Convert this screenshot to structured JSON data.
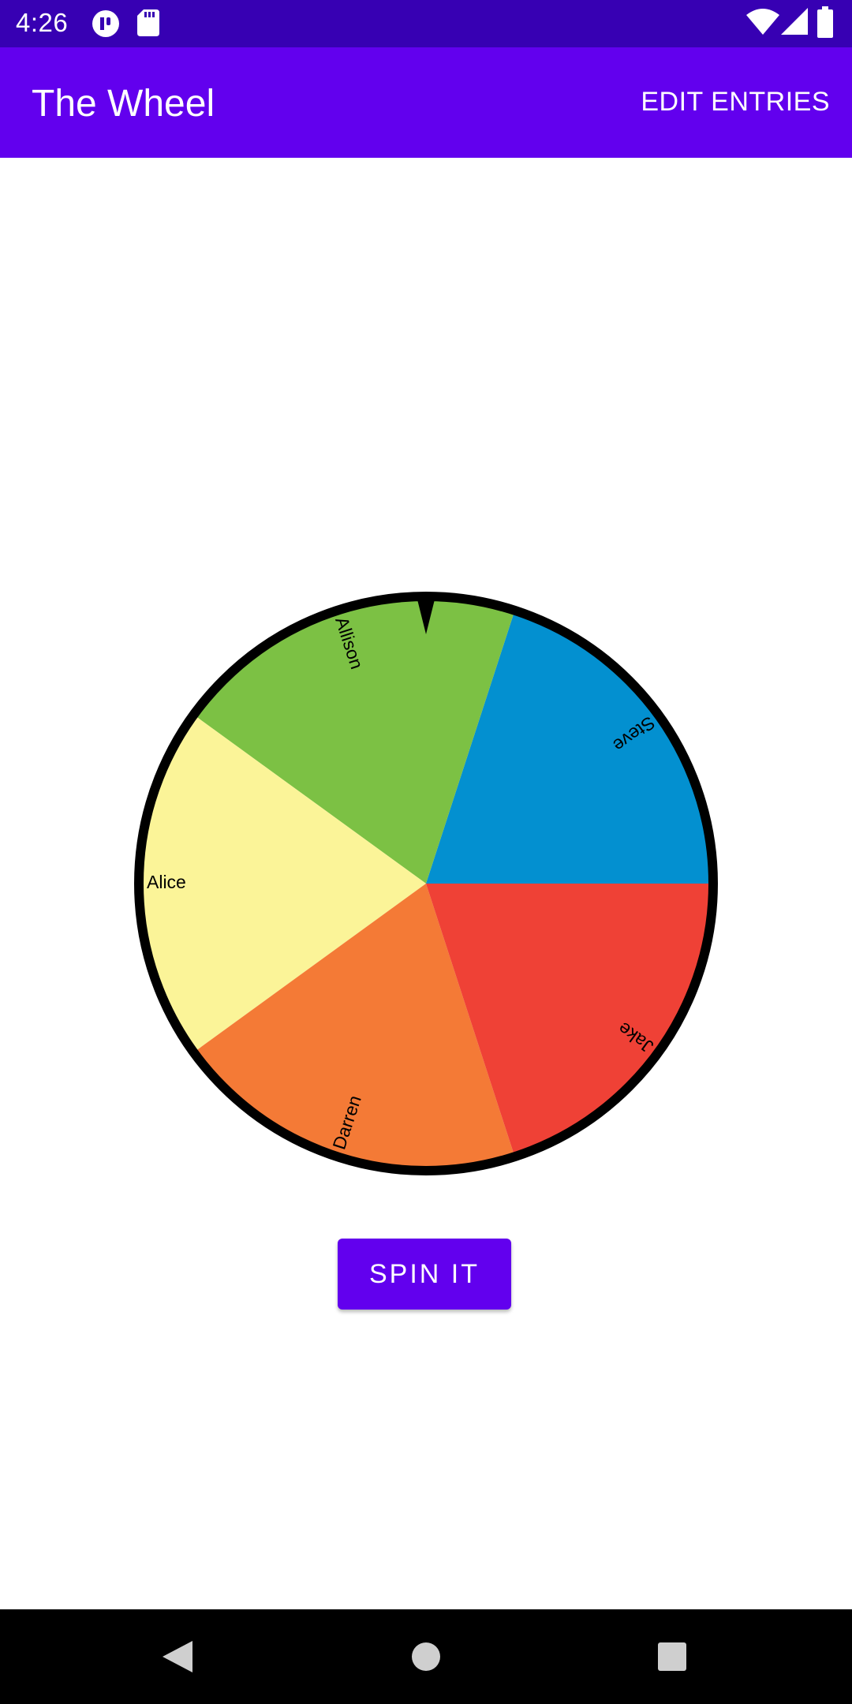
{
  "status_bar": {
    "time": "4:26",
    "icons": [
      "notification-app-icon",
      "sd-card-icon",
      "wifi-icon",
      "signal-icon",
      "battery-icon"
    ]
  },
  "app_bar": {
    "title": "The Wheel",
    "edit_label": "EDIT ENTRIES"
  },
  "wheel": {
    "entries": [
      {
        "name": "Steve",
        "color": "#0390d0"
      },
      {
        "name": "Allison",
        "color": "#7cc144"
      },
      {
        "name": "Alice",
        "color": "#fbf498"
      },
      {
        "name": "Darren",
        "color": "#f47a36"
      },
      {
        "name": "Jake",
        "color": "#ef4136"
      }
    ],
    "rim_color": "#000000",
    "pointer_color": "#000000"
  },
  "spin_button": {
    "label": "SPIN IT"
  },
  "nav_bar": {
    "buttons": [
      "back-icon",
      "home-icon",
      "recents-icon"
    ]
  },
  "colors": {
    "status_bar": "#3700b3",
    "app_bar": "#6200ee",
    "accent": "#6200ee"
  }
}
